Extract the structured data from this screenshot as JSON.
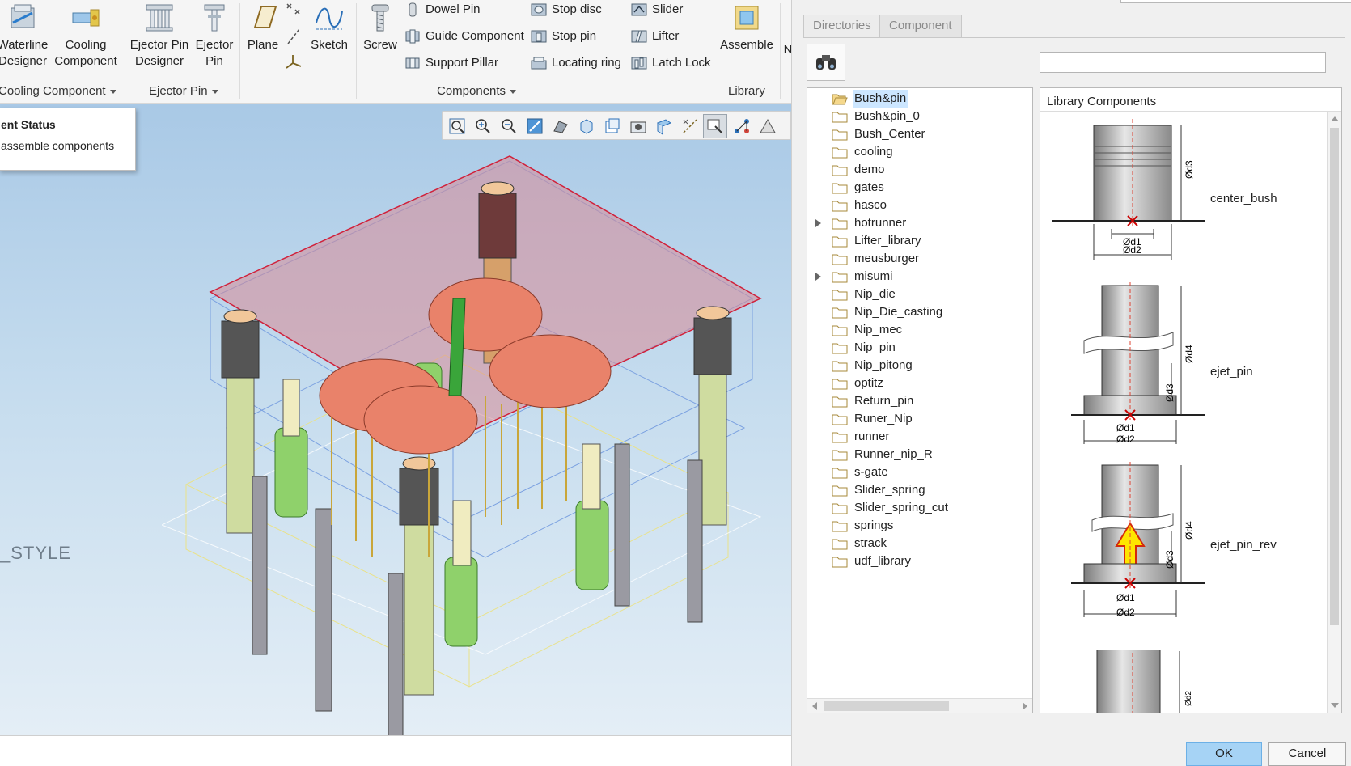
{
  "ribbon": {
    "cooling_group": {
      "label": "Cooling Component",
      "buttons": [
        {
          "line1": "Waterline",
          "line2": "Designer"
        },
        {
          "line1": "Cooling",
          "line2": "Component"
        }
      ]
    },
    "ejector_group": {
      "label": "Ejector Pin",
      "buttons": [
        {
          "line1": "Ejector Pin",
          "line2": "Designer"
        },
        {
          "line1": "Ejector",
          "line2": "Pin"
        }
      ]
    },
    "sketch_group": {
      "plane": "Plane",
      "sketch": "Sketch"
    },
    "components_group": {
      "label": "Components",
      "screw": "Screw",
      "col1": [
        "Dowel Pin",
        "Guide Component",
        "Support Pillar"
      ],
      "col2": [
        "Stop disc",
        "Stop pin",
        "Locating ring"
      ],
      "col3": [
        "Slider",
        "Lifter",
        "Latch Lock"
      ]
    },
    "library_group": {
      "label": "Library",
      "assemble": "Assemble",
      "cut_letter": "N"
    }
  },
  "tooltip": {
    "title": "ent Status",
    "text": "assemble components"
  },
  "viewport": {
    "style_text": "_STYLE"
  },
  "dialog": {
    "tabs": [
      "Directories",
      "Component"
    ],
    "search_value": "",
    "tree": [
      {
        "label": "Bush&pin",
        "selected": true,
        "open": true,
        "expandable": false
      },
      {
        "label": "Bush&pin_0",
        "expandable": false
      },
      {
        "label": "Bush_Center",
        "expandable": false
      },
      {
        "label": "cooling",
        "expandable": false
      },
      {
        "label": "demo",
        "expandable": false
      },
      {
        "label": "gates",
        "expandable": false
      },
      {
        "label": "hasco",
        "expandable": false
      },
      {
        "label": "hotrunner",
        "expandable": true
      },
      {
        "label": "Lifter_library",
        "expandable": false
      },
      {
        "label": "meusburger",
        "expandable": false
      },
      {
        "label": "misumi",
        "expandable": true
      },
      {
        "label": "Nip_die",
        "expandable": false
      },
      {
        "label": "Nip_Die_casting",
        "expandable": false
      },
      {
        "label": "Nip_mec",
        "expandable": false
      },
      {
        "label": "Nip_pin",
        "expandable": false
      },
      {
        "label": "Nip_pitong",
        "expandable": false
      },
      {
        "label": "optitz",
        "expandable": false
      },
      {
        "label": "Return_pin",
        "expandable": false
      },
      {
        "label": "Runer_Nip",
        "expandable": false
      },
      {
        "label": "runner",
        "expandable": false
      },
      {
        "label": "Runner_nip_R",
        "expandable": false
      },
      {
        "label": "s-gate",
        "expandable": false
      },
      {
        "label": "Slider_spring",
        "expandable": false
      },
      {
        "label": "Slider_spring_cut",
        "expandable": false
      },
      {
        "label": "springs",
        "expandable": false
      },
      {
        "label": "strack",
        "expandable": false
      },
      {
        "label": "udf_library",
        "expandable": false
      }
    ],
    "library_title": "Library Components",
    "components": [
      {
        "name": "center_bush",
        "dims": [
          "Ød3",
          "Ød1",
          "Ød2"
        ]
      },
      {
        "name": "ejet_pin",
        "dims": [
          "Ød4",
          "Ød3",
          "Ød1",
          "Ød2"
        ]
      },
      {
        "name": "ejet_pin_rev",
        "dims": [
          "Ød4",
          "Ød3",
          "Ød1",
          "Ød2"
        ]
      },
      {
        "name": "",
        "dims": [
          "Ød2"
        ]
      }
    ],
    "ok": "OK",
    "cancel": "Cancel"
  },
  "colors": {
    "selection": "#cce6ff",
    "ok_button": "#a6d3f5",
    "mold_plate": "#d98a95",
    "part": "#e9826a",
    "spring": "#8fd16b"
  }
}
